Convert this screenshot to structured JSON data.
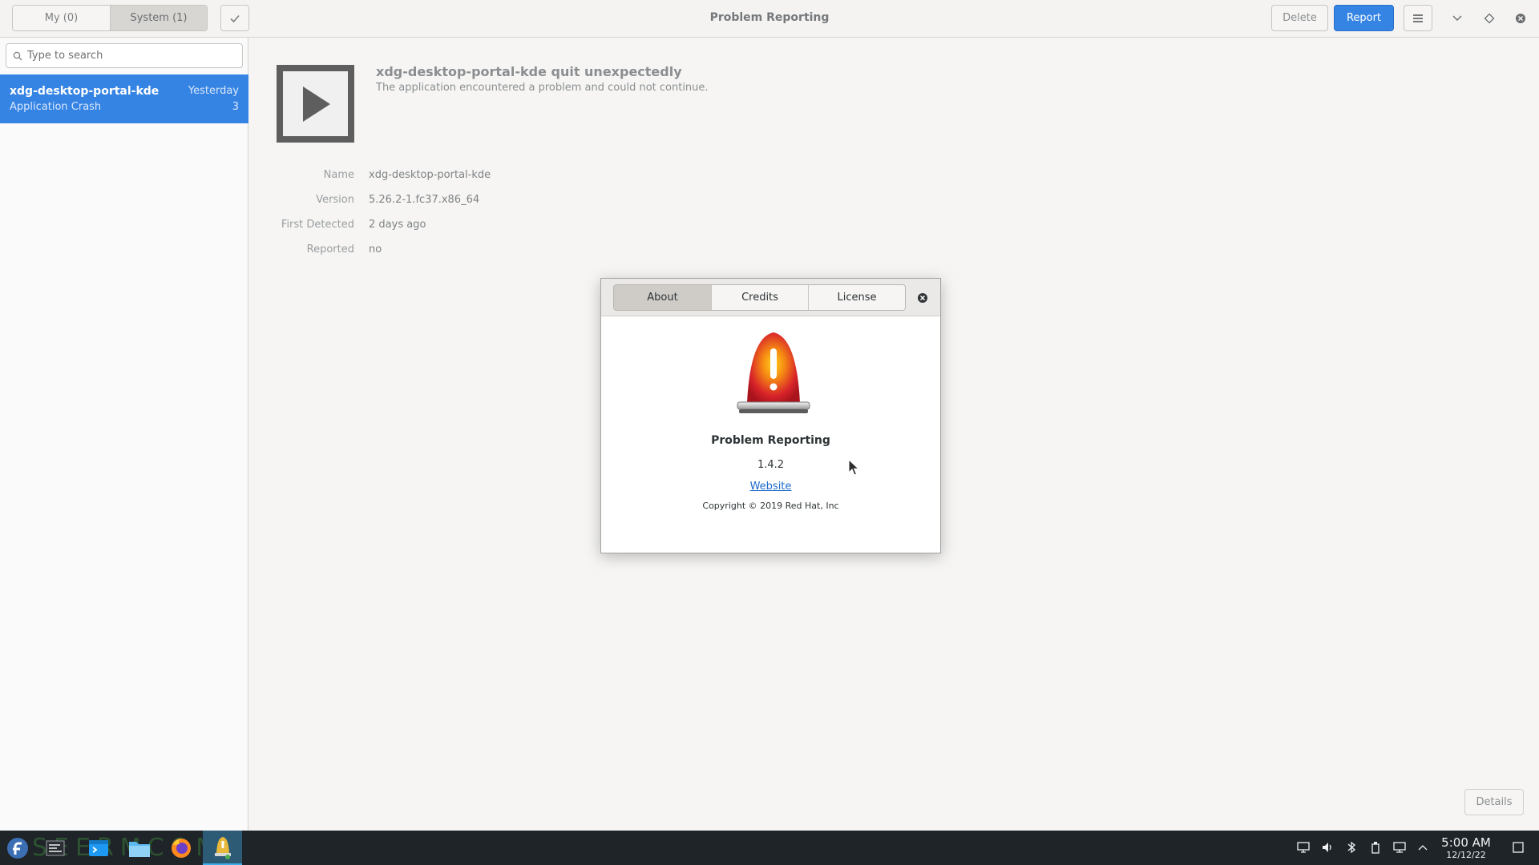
{
  "header": {
    "tabs": [
      {
        "label": "My (0)",
        "active": false
      },
      {
        "label": "System (1)",
        "active": true
      }
    ],
    "title": "Problem Reporting",
    "delete_label": "Delete",
    "report_label": "Report",
    "accent_color": "#3584e4"
  },
  "sidebar": {
    "search_placeholder": "Type to search",
    "items": [
      {
        "name": "xdg-desktop-portal-kde",
        "date": "Yesterday",
        "type": "Application Crash",
        "count": "3",
        "selected": true
      }
    ]
  },
  "problem": {
    "title": "xdg-desktop-portal-kde quit unexpectedly",
    "subtitle": "The application encountered a problem and could not continue.",
    "properties": [
      {
        "key": "Name",
        "value": "xdg-desktop-portal-kde"
      },
      {
        "key": "Version",
        "value": "5.26.2-1.fc37.x86_64"
      },
      {
        "key": "First Detected",
        "value": "2 days ago"
      },
      {
        "key": "Reported",
        "value": "no"
      }
    ],
    "details_label": "Details"
  },
  "about_dialog": {
    "tabs": [
      {
        "label": "About",
        "active": true
      },
      {
        "label": "Credits",
        "active": false
      },
      {
        "label": "License",
        "active": false
      }
    ],
    "app_name": "Problem Reporting",
    "version": "1.4.2",
    "website_label": "Website",
    "copyright": "Copyright © 2019 Red Hat, Inc"
  },
  "taskbar": {
    "apps": [
      "fedora-launcher-icon",
      "task-manager-icon",
      "konsole-icon",
      "file-manager-icon",
      "firefox-icon",
      "problem-reporting-icon"
    ],
    "watermark": "SEERMCOM",
    "time": "5:00 AM",
    "date": "12/12/22"
  }
}
